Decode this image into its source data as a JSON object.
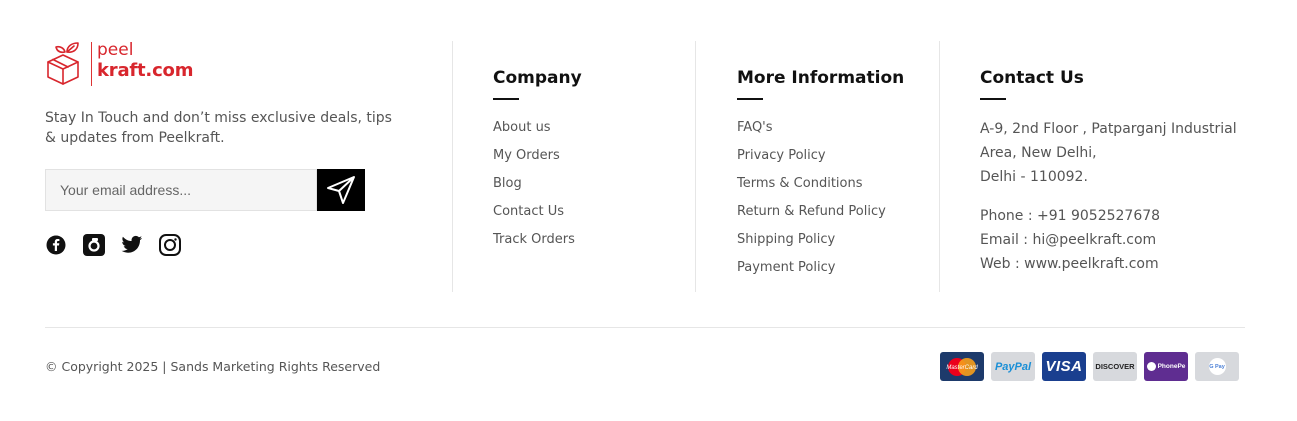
{
  "brand": {
    "logo_top": "peel",
    "logo_bottom": "kraft.com",
    "tagline": "Stay In Touch and don’t miss exclusive deals, tips & updates from Peelkraft.",
    "email_placeholder": "Your email address...",
    "accent_color": "#d8262d"
  },
  "social": [
    "facebook-icon",
    "snapchat-icon",
    "twitter-icon",
    "instagram-icon"
  ],
  "company": {
    "title": "Company",
    "links": [
      "About us",
      "My Orders",
      "Blog",
      "Contact Us",
      "Track Orders"
    ]
  },
  "more_info": {
    "title": "More Information",
    "links": [
      "FAQ's",
      "Privacy Policy",
      "Terms & Conditions",
      "Return & Refund Policy",
      "Shipping Policy",
      "Payment Policy"
    ]
  },
  "contact": {
    "title": "Contact Us",
    "address_line1": "A-9, 2nd Floor , Patparganj Industrial",
    "address_line2": "Area, New Delhi,",
    "address_line3": "Delhi - 110092.",
    "phone": "Phone : +91 9052527678",
    "email": "Email : hi@peelkraft.com",
    "web": "Web  : www.peelkraft.com"
  },
  "bottom": {
    "copyright": "© Copyright 2025 | Sands Marketing Rights Reserved",
    "payments": {
      "mastercard": "MasterCard",
      "paypal": "PayPal",
      "visa": "VISA",
      "discover": "DISCOVER",
      "phonepe": "PhonePe",
      "gpay": "G Pay"
    }
  }
}
